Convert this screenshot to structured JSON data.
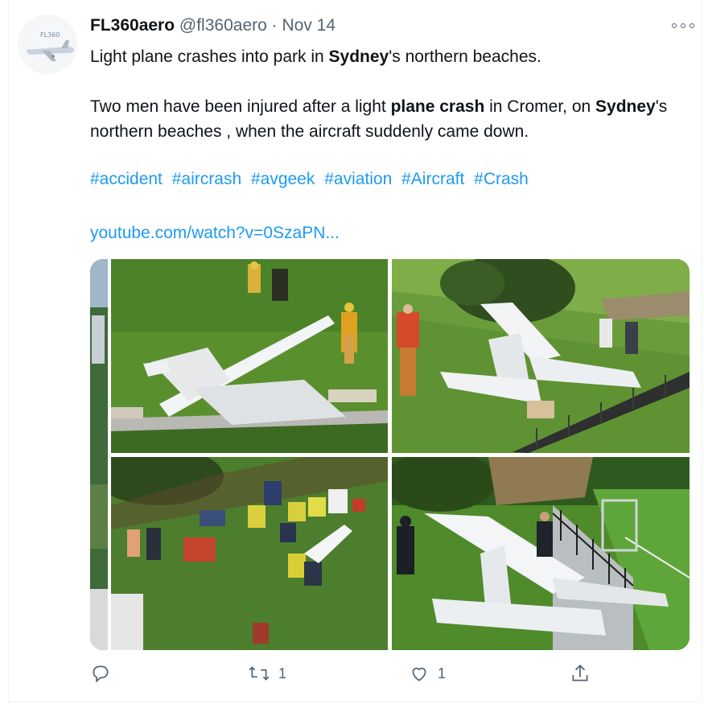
{
  "tweet": {
    "display_name": "FL360aero",
    "handle": "@fl360aero",
    "separator": "·",
    "date": "Nov 14",
    "avatar_text": "FL360",
    "line1": {
      "pre": "Light plane crashes into park in ",
      "bold": "Sydney",
      "post": "'s northern beaches."
    },
    "line2": {
      "pre": "Two men have been injured after a light ",
      "bold1": "plane crash",
      "mid": " in Cromer, on ",
      "bold2": "Sydney",
      "post": "'s"
    },
    "line3": "northern beaches , when the aircraft suddenly came down.",
    "hashtags": [
      "#accident",
      "#aircrash",
      "#avgeek",
      "#aviation",
      "#Aircraft",
      " #Crash"
    ],
    "link": "youtube.com/watch?v=0SzaPN..."
  },
  "actions": {
    "reply_count": "",
    "retweet_count": "1",
    "like_count": "1"
  },
  "colors": {
    "link": "#1d9bf0",
    "muted": "#536471",
    "grass": "#4f8a2b",
    "plane": "#eef0f2"
  },
  "icons": [
    "more-icon",
    "reply-icon",
    "retweet-icon",
    "like-icon",
    "share-icon"
  ]
}
